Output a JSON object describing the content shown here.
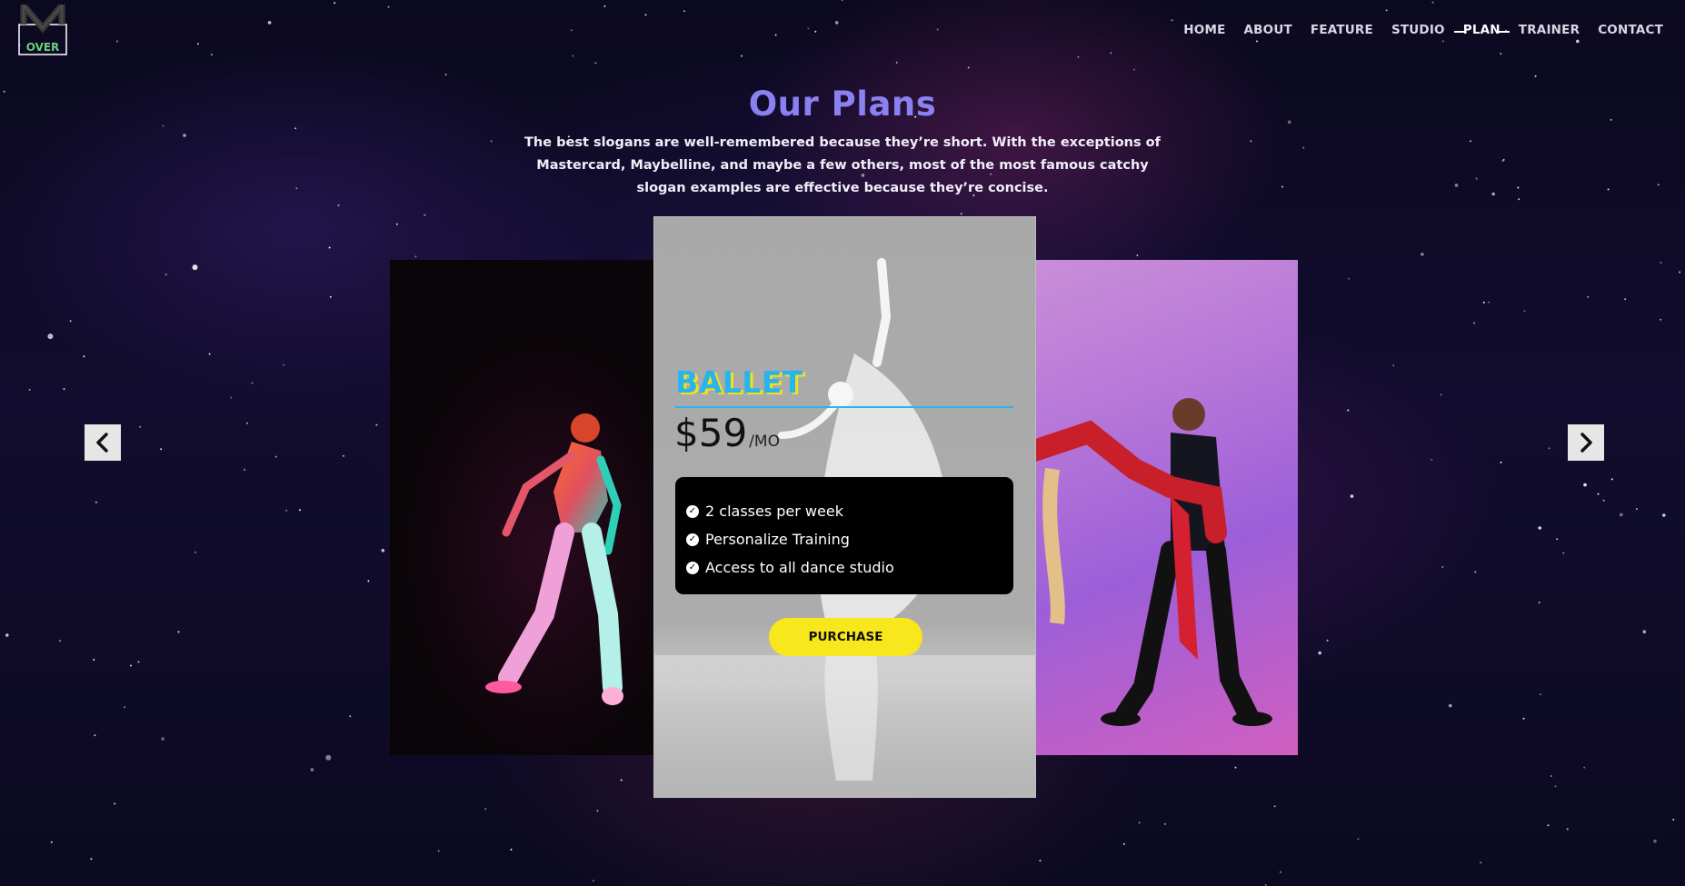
{
  "header": {
    "logo_text": "OVER",
    "nav": [
      {
        "label": "HOME",
        "active": false
      },
      {
        "label": "ABOUT",
        "active": false
      },
      {
        "label": "FEATURE",
        "active": false
      },
      {
        "label": "STUDIO",
        "active": false
      },
      {
        "label": "PLAN",
        "active": true
      },
      {
        "label": "TRAINER",
        "active": false
      },
      {
        "label": "CONTACT",
        "active": false
      }
    ]
  },
  "section": {
    "title": "Our Plans",
    "description": "The best slogans are well-remembered because they’re short. With the exceptions of Mastercard, Maybelline, and maybe a few others, most of the most famous catchy slogan examples are effective because they’re concise."
  },
  "plan": {
    "name": "BALLET",
    "price": "$59",
    "unit": "/MO",
    "features": [
      "2 classes per week",
      "Personalize Training",
      "Access to all dance studio"
    ],
    "purchase_label": "PURCHASE"
  },
  "carousel": {
    "prev_icon": "chevron-left-icon",
    "next_icon": "chevron-right-icon"
  },
  "colors": {
    "title": "#8a80f0",
    "plan_name": "#2ab4ee",
    "plan_shadow": "#f2e216",
    "purchase_button": "#f8e71c"
  }
}
